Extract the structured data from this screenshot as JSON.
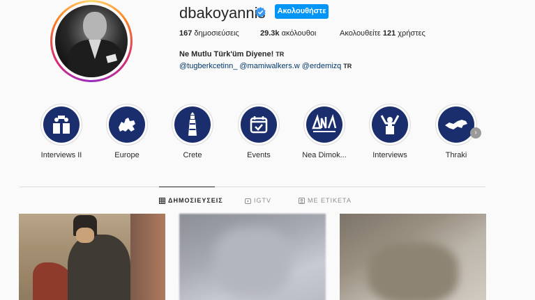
{
  "profile": {
    "username": "dbakoyannis",
    "follow_label": "Ακολουθήστε",
    "posts_count": "167",
    "posts_label": "δημοσιεύσεις",
    "followers_count": "29.3k",
    "followers_label": "ακόλουθοι",
    "following_prefix": "Ακολουθείτε",
    "following_count": "121",
    "following_label": "χρήστες",
    "bio_name": "Ne Mutlu Türk'üm Diyene!",
    "bio_flag": "TR",
    "bio_links": "@tugberkcetinn_ @mamiwalkers.w @erdemizq",
    "bio_links_flag": "TR"
  },
  "highlights": [
    {
      "label": "Interviews II",
      "icon": "podium-speakers-icon"
    },
    {
      "label": "Europe",
      "icon": "europe-map-icon"
    },
    {
      "label": "Crete",
      "icon": "lighthouse-icon"
    },
    {
      "label": "Events",
      "icon": "calendar-check-icon"
    },
    {
      "label": "Nea Dimok...",
      "icon": "nea-dimokratia-logo-icon"
    },
    {
      "label": "Interviews",
      "icon": "speaker-arms-up-icon"
    },
    {
      "label": "Thraki",
      "icon": "thraki-map-icon"
    }
  ],
  "tabs": [
    {
      "label": "ΔΗΜΟΣΙΕΥΣΕΙΣ",
      "icon": "grid-icon",
      "active": true
    },
    {
      "label": "IGTV",
      "icon": "igtv-icon",
      "active": false
    },
    {
      "label": "ΜΕ ΕΤΙΚΕΤΑ",
      "icon": "tagged-icon",
      "active": false
    }
  ],
  "colors": {
    "accent": "#0095f6",
    "highlight_bg": "#1a2e6e"
  }
}
